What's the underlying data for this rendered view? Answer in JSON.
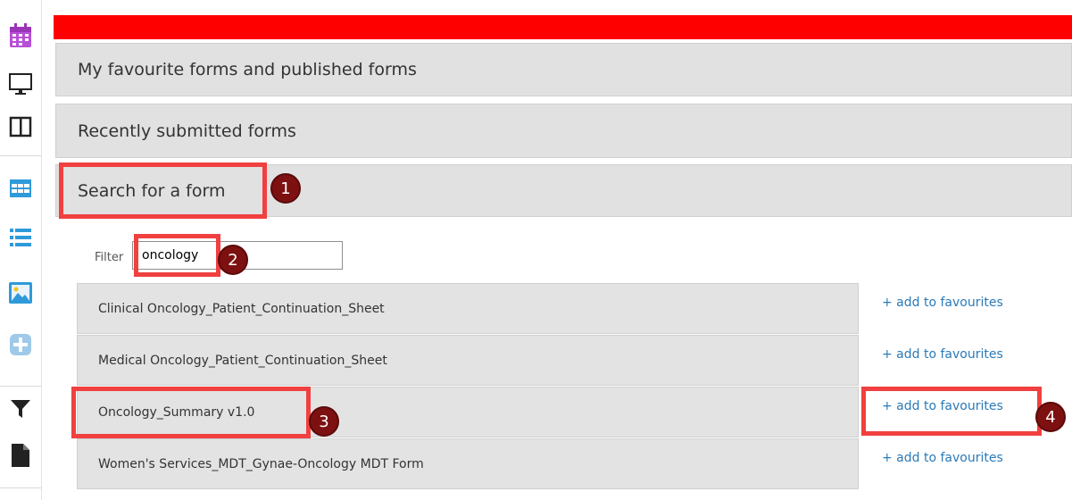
{
  "sidebar": {
    "icons": [
      "calendar-icon",
      "monitor-icon",
      "columns-icon",
      "table-icon",
      "list-icon",
      "image-icon",
      "plus-icon",
      "filter-icon",
      "document-icon"
    ]
  },
  "panels": {
    "favourites": "My favourite forms and published forms",
    "recent": "Recently submitted forms",
    "search": "Search for a form"
  },
  "filter": {
    "label": "Filter",
    "value": "oncology"
  },
  "results": [
    {
      "name": "Clinical Oncology_Patient_Continuation_Sheet",
      "action": "+ add to favourites"
    },
    {
      "name": "Medical Oncology_Patient_Continuation_Sheet",
      "action": "+ add to favourites"
    },
    {
      "name": "Oncology_Summary v1.0",
      "action": "+ add to favourites"
    },
    {
      "name": "Women's Services_MDT_Gynae-Oncology MDT Form",
      "action": "+ add to favourites"
    }
  ],
  "callouts": [
    "1",
    "2",
    "3",
    "4"
  ],
  "colors": {
    "alert_bar": "#ff0000",
    "callout_border": "#f04040",
    "badge": "#7d1010",
    "link": "#2a7ab8",
    "accent_icon": "#2e9ad9",
    "calendar_icon": "#b84fd6"
  }
}
